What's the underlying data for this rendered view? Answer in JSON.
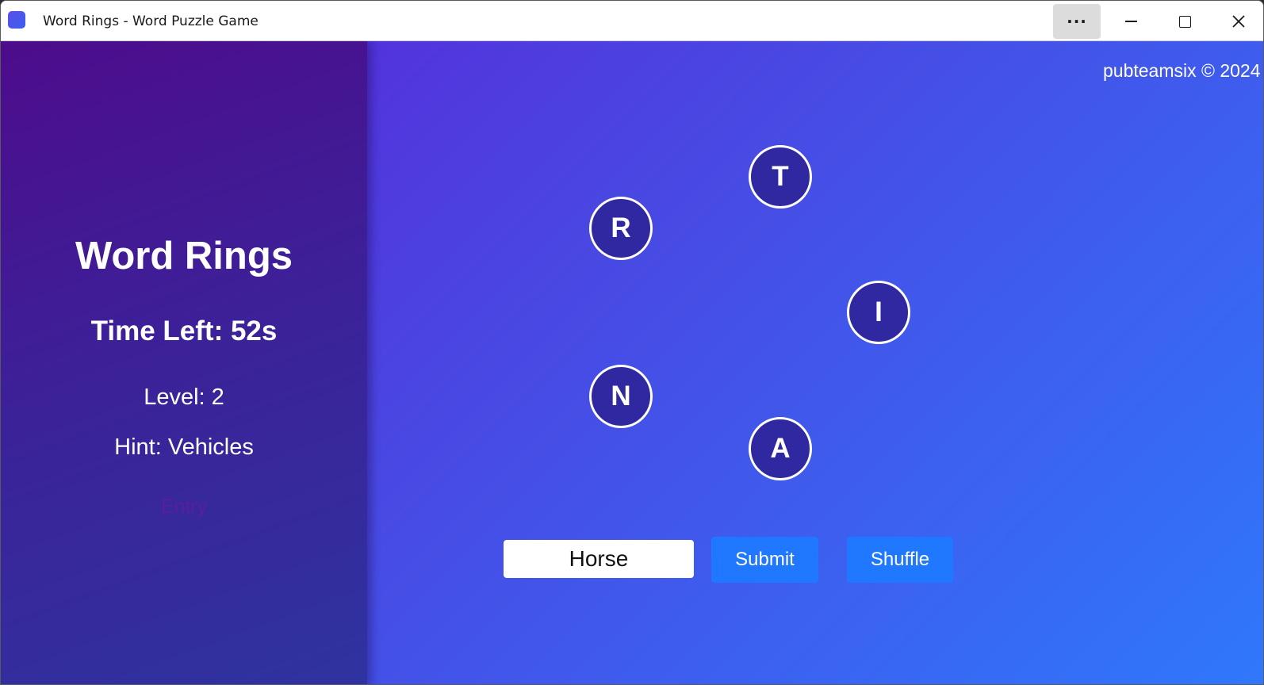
{
  "window": {
    "title": "Word Rings - Word Puzzle Game",
    "more_label": "···",
    "close_label": "✕"
  },
  "sidebar": {
    "title": "Word Rings",
    "timer": "Time Left: 52s",
    "level": "Level: 2",
    "hint": "Hint: Vehicles",
    "status": "Entry"
  },
  "main": {
    "copyright": "pubteamsix © 2024",
    "letters": [
      "T",
      "R",
      "I",
      "N",
      "A"
    ],
    "word_input_value": "Horse",
    "submit_label": "Submit",
    "shuffle_label": "Shuffle"
  },
  "colors": {
    "accent": "#1f78ff",
    "letter_fill": "#3028a0",
    "sidebar_top": "#4d0c8c",
    "background_end": "#2f78fb"
  }
}
